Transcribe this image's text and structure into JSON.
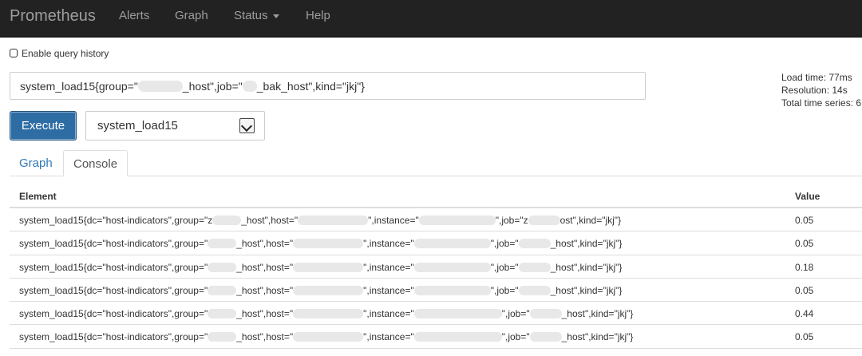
{
  "navbar": {
    "brand": "Prometheus",
    "items": [
      "Alerts",
      "Graph",
      "Status",
      "Help"
    ]
  },
  "query_history": {
    "label": "Enable query history",
    "checked": false
  },
  "expression": {
    "part1": "system_load15{group=\"",
    "part2": "_host\",job=\"",
    "part3": "_bak_host\",kind=\"jkj\"}"
  },
  "stats": {
    "load_time": "Load time: 77ms",
    "resolution": "Resolution: 14s",
    "total_series": "Total time series: 6"
  },
  "execute_label": "Execute",
  "metric_select": {
    "selected": "system_load15"
  },
  "tabs": [
    "Graph",
    "Console"
  ],
  "active_tab": "Console",
  "table": {
    "headers": {
      "element": "Element",
      "value": "Value"
    },
    "rows": [
      {
        "p1": "system_load15{dc=\"host-indicators\",group=\"z",
        "p2": "_host\",host=\"",
        "p3": "\",instance=\"",
        "p4": "\",job=\"z",
        "p5": "ost\",kind=\"jkj\"}",
        "value": "0.05"
      },
      {
        "p1": "system_load15{dc=\"host-indicators\",group=\"",
        "p2": "_host\",host=\"",
        "p3": "\",instance=\"",
        "p4": "\",job=\"",
        "p5": "_host\",kind=\"jkj\"}",
        "value": "0.05"
      },
      {
        "p1": "system_load15{dc=\"host-indicators\",group=\"",
        "p2": "_host\",host=\"",
        "p3": "\",instance=\"",
        "p4": "\",job=\"",
        "p5": "_host\",kind=\"jkj\"}",
        "value": "0.18"
      },
      {
        "p1": "system_load15{dc=\"host-indicators\",group=\"",
        "p2": "_host\",host=\"",
        "p3": "\",instance=\"",
        "p4": "\",job=\"",
        "p5": "_host\",kind=\"jkj\"}",
        "value": "0.05"
      },
      {
        "p1": "system_load15{dc=\"host-indicators\",group=\"",
        "p2": "_host\",host=\"",
        "p3": "\",instance=\"",
        "p4": "\",job=\"",
        "p5": "_host\",kind=\"jkj\"}",
        "value": "0.44"
      },
      {
        "p1": "system_load15{dc=\"host-indicators\",group=\"",
        "p2": "_host\",host=\"",
        "p3": "\",instance=\"",
        "p4": "\",job=\"",
        "p5": "_host\",kind=\"jkj\"}",
        "value": "0.05"
      }
    ]
  },
  "colors": {
    "navbar_bg": "#222222",
    "navbar_text": "#9d9d9d",
    "execute_bg": "#2e6da4",
    "link": "#337ab7"
  }
}
